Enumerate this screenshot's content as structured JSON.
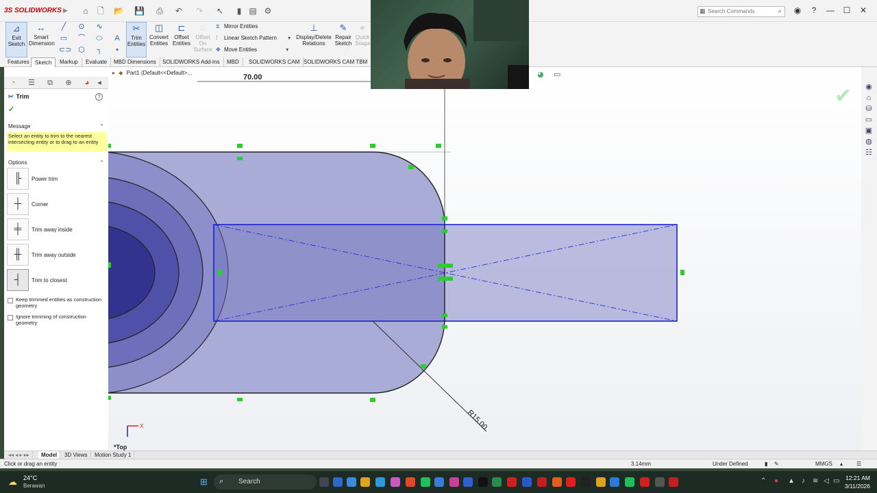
{
  "app": {
    "logo_text": "3S SOLIDWORKS",
    "search_placeholder": "Search Commands",
    "window_controls": [
      "minimize",
      "maximize",
      "close"
    ]
  },
  "command_manager": {
    "exit_sketch": "Exit Sketch",
    "smart_dimension": "Smart Dimension",
    "trim_entities": "Trim Entities",
    "convert_entities": "Convert Entities",
    "offset_entities": "Offset Entities",
    "offset_on_surface": "Offset On Surface",
    "mirror_entities": "Mirror Entities",
    "linear_sketch_pattern": "Linear Sketch Pattern",
    "move_entities": "Move Entities",
    "display_delete_relations": "Display/Delete Relations",
    "repair_sketch": "Repair Sketch",
    "quick_snaps": "Quick Snaps"
  },
  "tabs": [
    "Features",
    "Sketch",
    "Markup",
    "Evaluate",
    "MBD Dimensions",
    "SOLIDWORKS Add-Ins",
    "MBD",
    "SOLIDWORKS CAM",
    "SOLIDWORKS CAM TBM"
  ],
  "active_tab": "Sketch",
  "property_manager": {
    "title": "Trim",
    "message_header": "Message",
    "message": "Select an entity to trim to the nearest intersecting entity or to drag to an entity",
    "options_header": "Options",
    "options": [
      "Power trim",
      "Corner",
      "Trim away inside",
      "Trim away outside",
      "Trim to closest"
    ],
    "selected_option": "Trim to closest",
    "checkbox1": "Keep trimmed entities as construction geometry",
    "checkbox2": "Ignore trimming of construction geometry"
  },
  "graphics": {
    "feature_tree_label": "Part1  (Default<<Default>...",
    "dimension_top": "70.00",
    "dimension_radius": "R15.00",
    "view_label": "*Top",
    "triad_x": "X",
    "sketch_fill": "#a9acd6",
    "rect_stroke": "#1a22d0",
    "relation_color": "#2ad02a"
  },
  "bottom_tabs": [
    "Model",
    "3D Views",
    "Motion Study 1"
  ],
  "active_bottom_tab": "Model",
  "status": {
    "prompt": "Click or drag an entity",
    "coordinate": "3.14mm",
    "state": "Under Defined",
    "units": "MMGS"
  },
  "taskbar": {
    "temperature": "24°C",
    "weather": "Berawan",
    "search": "Search",
    "time": "12:21 AM",
    "date": "3/11/2026"
  }
}
